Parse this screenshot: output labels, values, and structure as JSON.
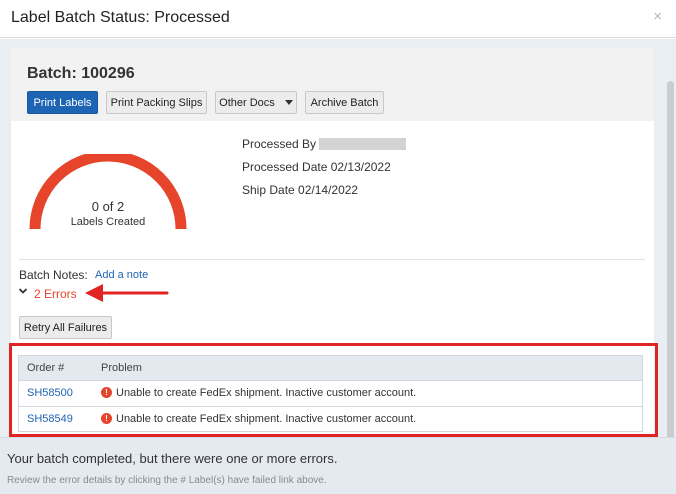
{
  "dialog": {
    "title": "Label Batch Status: Processed",
    "close_glyph": "×"
  },
  "batch": {
    "title": "Batch: 100296",
    "buttons": {
      "print_labels": "Print Labels",
      "print_packing_slips": "Print Packing Slips",
      "other_docs": "Other Docs",
      "archive_batch": "Archive Batch"
    }
  },
  "gauge": {
    "count_text": "0 of 2",
    "label": "Labels Created",
    "created": 0,
    "total": 2,
    "color": "#e6452b"
  },
  "info": {
    "processed_by_label": "Processed By",
    "processed_date": "Processed Date 02/13/2022",
    "ship_date": "Ship Date 02/14/2022"
  },
  "notes": {
    "label": "Batch Notes:",
    "add_note": "Add a note"
  },
  "errors": {
    "toggle_label": "2 Errors",
    "retry_label": "Retry All Failures",
    "columns": [
      "Order #",
      "Problem"
    ],
    "rows": [
      {
        "order": "SH58500",
        "problem": "Unable to create FedEx shipment. Inactive customer account."
      },
      {
        "order": "SH58549",
        "problem": "Unable to create FedEx shipment. Inactive customer account."
      }
    ]
  },
  "footer": {
    "message": "Your batch completed, but there were one or more errors.",
    "hint": "Review the error details by clicking the # Label(s) have failed link above."
  },
  "colors": {
    "primary": "#1e64b4",
    "error": "#e6452b",
    "annotation": "#e02424"
  }
}
